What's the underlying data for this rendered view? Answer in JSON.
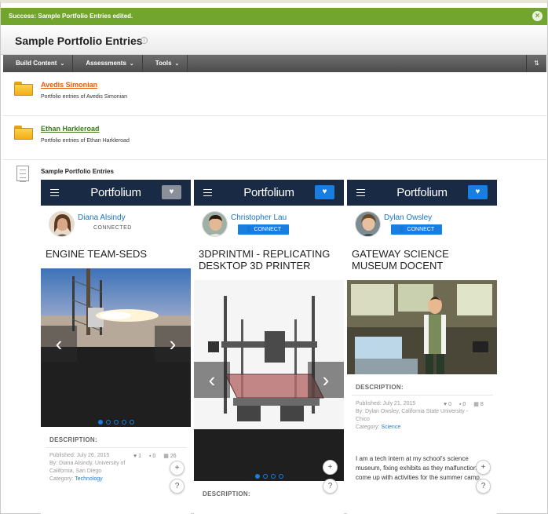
{
  "success_message": "Success: Sample Portfolio Entries edited.",
  "page_title": "Sample Portfolio Entries",
  "action_bar": {
    "items": [
      {
        "label": "Build Content"
      },
      {
        "label": "Assessments"
      },
      {
        "label": "Tools"
      }
    ],
    "sort_icon": "sort-icon"
  },
  "entries": [
    {
      "name": "Avedis Simonian",
      "description": "Portfolio entries of Avedis Simonian",
      "color": "#e25a0e"
    },
    {
      "name": "Ethan Harkleroad",
      "description": "Portfolio entries of Ethan Harkleroad",
      "color": "#3a7a1a"
    }
  ],
  "portfolio_section_title": "Sample Portfolio Entries",
  "cards": [
    {
      "logo": "Portfolium",
      "user": "Diana Alsindy",
      "status": "CONNECTED",
      "title": "ENGINE TEAM-SEDS",
      "heart_color": "#8a8f99",
      "description_label": "DESCRIPTION:",
      "published": "Published: July 26, 2015",
      "by": "By: Diana Alsindy, University of California, San Diego",
      "category_label": "Category:",
      "category": "Technology",
      "likes": "1",
      "comments": "0",
      "views": "26",
      "total_slides": 5,
      "active_slide": 1
    },
    {
      "logo": "Portfolium",
      "user": "Christopher Lau",
      "status": "CONNECT",
      "title": "3DPRINTMI - REPLICATING DESKTOP 3D PRINTER",
      "heart_color": "#1a7de0",
      "description_label": "DESCRIPTION:",
      "total_slides": 4,
      "active_slide": 1
    },
    {
      "logo": "Portfolium",
      "user": "Dylan Owsley",
      "status": "CONNECT",
      "title": "GATEWAY SCIENCE MUSEUM DOCENT",
      "heart_color": "#1a7de0",
      "description_label": "DESCRIPTION:",
      "published": "Published: July 21, 2015",
      "by": "By: Dylan Owsley, California State University - Chico",
      "category_label": "Category:",
      "category": "Science",
      "likes": "0",
      "comments": "0",
      "views": "8",
      "body": "I am a tech intern at my school's science museum, fixing exhibits as they malfunction and come up with activities for the summer camp."
    }
  ],
  "fab": {
    "plus": "+",
    "help": "?"
  }
}
